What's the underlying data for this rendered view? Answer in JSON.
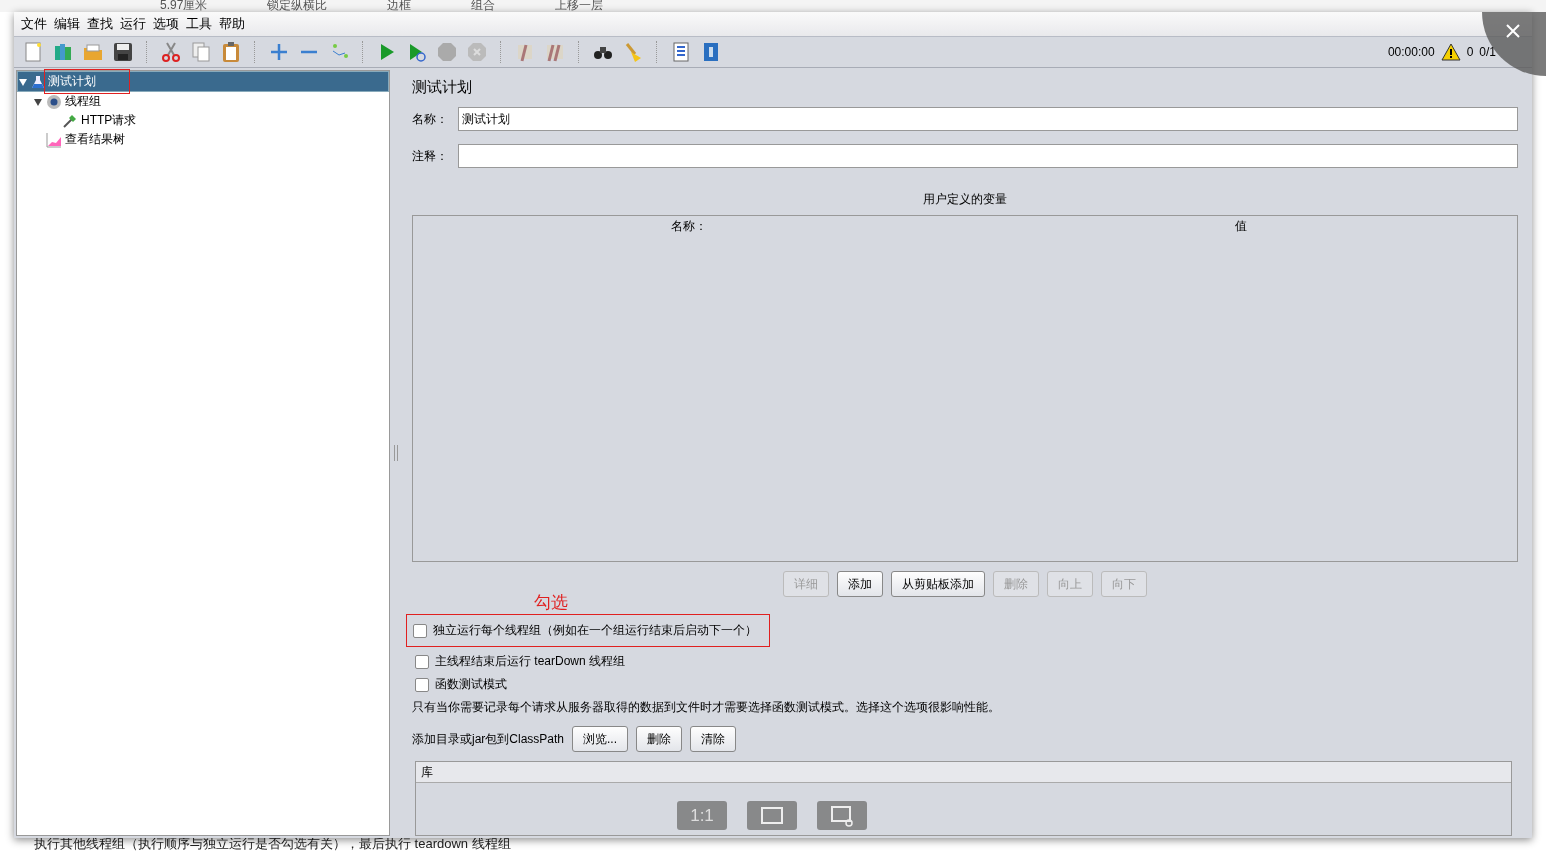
{
  "background_toolbar": {
    "items": [
      "5.97厘米",
      "锁定纵横比",
      "边框",
      "组合",
      "上移一层"
    ]
  },
  "menu": [
    "文件",
    "编辑",
    "查找",
    "运行",
    "选项",
    "工具",
    "帮助"
  ],
  "status": {
    "time": "00:00:00",
    "warnings": "0",
    "threads": "0/1"
  },
  "tree": [
    {
      "label": "测试计划",
      "kind": "plan",
      "selected": true,
      "highlighted": true,
      "expanded": true,
      "children": [
        {
          "label": "线程组",
          "kind": "thread-group",
          "selected": false,
          "expanded": true,
          "children": [
            {
              "label": "HTTP请求",
              "kind": "sampler",
              "selected": false
            }
          ]
        },
        {
          "label": "查看结果树",
          "kind": "listener",
          "selected": false
        }
      ]
    }
  ],
  "panel": {
    "title": "测试计划",
    "fields": [
      {
        "label": "名称：",
        "value": "测试计划"
      },
      {
        "label": "注释："
      }
    ],
    "variables": {
      "title": "用户定义的变量",
      "columns": [
        "名称：",
        "值"
      ],
      "buttons": [
        {
          "label": "详细",
          "disabled": true
        },
        {
          "label": "添加",
          "disabled": false
        },
        {
          "label": "从剪贴板添加",
          "disabled": false
        },
        {
          "label": "删除",
          "disabled": true
        },
        {
          "label": "向上",
          "disabled": true
        },
        {
          "label": "向下",
          "disabled": true
        }
      ]
    },
    "options": [
      {
        "label": "独立运行每个线程组（例如在一个组运行结束后启动下一个）",
        "checked": false,
        "highlighted": true
      },
      {
        "label": "主线程结束后运行 tearDown 线程组",
        "checked": false,
        "highlighted": false
      },
      {
        "label": "函数测试模式",
        "checked": false,
        "highlighted": false
      }
    ],
    "note": "只有当你需要记录每个请求从服务器取得的数据到文件时才需要选择函数测试模式。选择这个选项很影响性能。",
    "classpath": {
      "label": "添加目录或jar包到ClassPath",
      "buttons": [
        "浏览...",
        "删除",
        "清除"
      ],
      "columns": [
        "库"
      ]
    }
  },
  "annotation": {
    "label": "勾选"
  },
  "capture_tools": {
    "zoom_label": "1:1"
  },
  "background_text": "执行其他线程组（执行顺序与独立运行是否勾选有关），最后执行 teardown 线程组"
}
